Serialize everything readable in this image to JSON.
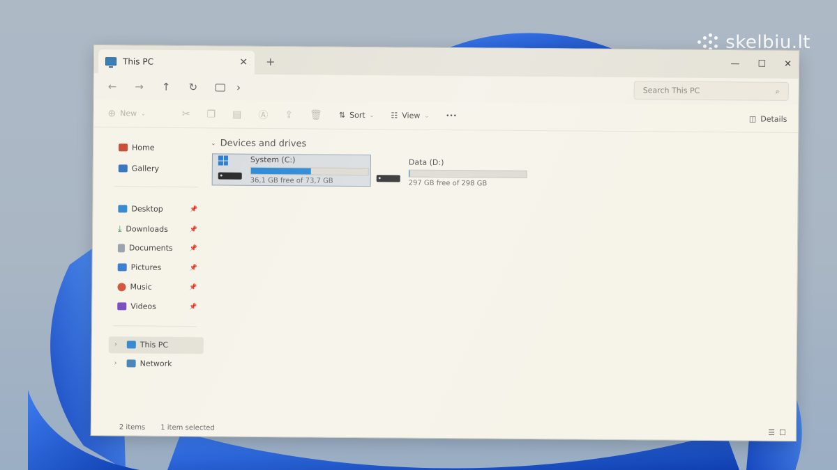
{
  "watermark": {
    "text": "skelbiu.lt"
  },
  "window": {
    "tab_title": "This PC",
    "tab_close": "✕",
    "new_tab": "+",
    "controls": {
      "minimize": "—",
      "maximize": "☐",
      "close": "✕"
    }
  },
  "address": {
    "back": "←",
    "forward": "→",
    "up": "↑",
    "refresh": "↻",
    "chevron": "›",
    "search_placeholder": "Search This PC",
    "search_icon": "⌕"
  },
  "toolbar": {
    "new_label": "New",
    "sort_label": "Sort",
    "view_label": "View",
    "more": "•••",
    "details_label": "Details"
  },
  "sidebar": {
    "home": "Home",
    "gallery": "Gallery",
    "desktop": "Desktop",
    "downloads": "Downloads",
    "documents": "Documents",
    "pictures": "Pictures",
    "music": "Music",
    "videos": "Videos",
    "thispc": "This PC",
    "network": "Network"
  },
  "content": {
    "section_title": "Devices and drives",
    "drives": [
      {
        "label": "System (C:)",
        "free_text": "36,1 GB free of 73,7 GB",
        "used_fraction": 0.51
      },
      {
        "label": "Data (D:)",
        "free_text": "297 GB free of 298 GB",
        "used_fraction": 0.003
      }
    ]
  },
  "status": {
    "items": "2 items",
    "selected": "1 item selected"
  },
  "colors": {
    "accent": "#2d89d6",
    "window_bg": "#f6f3e9",
    "desktop_bloom": "#1f5fd6"
  }
}
